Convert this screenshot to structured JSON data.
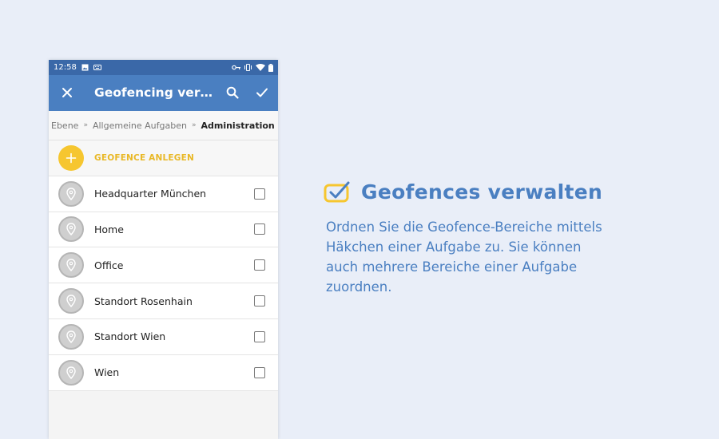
{
  "status_bar": {
    "time": "12:58"
  },
  "app_bar": {
    "title": "Geofencing verwalten",
    "close_icon": "close-icon",
    "search_icon": "search-icon",
    "confirm_icon": "check-icon"
  },
  "breadcrumb": {
    "items": [
      "Ebene",
      "Allgemeine Aufgaben"
    ],
    "separator": "»",
    "current": "Administration"
  },
  "create_geofence": {
    "label": "GEOFENCE ANLEGEN",
    "icon": "plus-icon"
  },
  "geofences": [
    {
      "name": "Headquarter München",
      "checked": false
    },
    {
      "name": "Home",
      "checked": false
    },
    {
      "name": "Office",
      "checked": false
    },
    {
      "name": "Standort Rosenhain",
      "checked": false
    },
    {
      "name": "Standort Wien",
      "checked": false
    },
    {
      "name": "Wien",
      "checked": false
    }
  ],
  "promo": {
    "title": "Geofences verwalten",
    "text": "Ordnen Sie die Geofence-Bereiche mittels Häkchen einer Aufgabe zu. Sie können auch mehrere Bereiche einer Aufgabe zuordnen."
  },
  "colors": {
    "background": "#e9eef8",
    "status_bar": "#3a68a8",
    "app_bar": "#4a7fc1",
    "accent_yellow": "#f6c62f",
    "promo_text": "#4a7fc1"
  }
}
